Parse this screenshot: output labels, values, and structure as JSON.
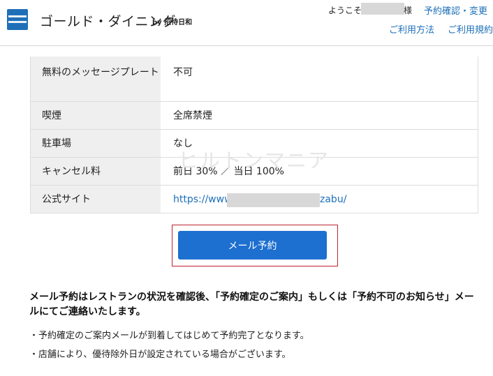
{
  "header": {
    "brand": "ゴールド・ダイニング",
    "brand_by": "by 招待日和",
    "welcome_prefix": "ようこそ",
    "welcome_suffix": "様",
    "links": [
      "予約確認・変更",
      "ご利用方法",
      "ご利用規約"
    ]
  },
  "details": {
    "rows": [
      {
        "label": "無料のメッセージプレート",
        "value": "不可"
      },
      {
        "label": "喫煙",
        "value": "全席禁煙"
      },
      {
        "label": "駐車場",
        "value": "なし"
      },
      {
        "label": "キャンセル料",
        "value": "前日 30% ／ 当日 100%"
      },
      {
        "label": "公式サイト",
        "value_prefix": "https://www",
        "value_suffix": "zabu/"
      }
    ]
  },
  "watermark": "ヒルトンマニア",
  "mail_button": "メール予約",
  "notice": "メール予約はレストランの状況を確認後、「予約確定のご案内」もしくは「予約不可のお知らせ」メールにてご連絡いたします。",
  "bullets": [
    "・予約確定のご案内メールが到着してはじめて予約完了となります。",
    "・店舗により、優待除外日が設定されている場合がございます。"
  ],
  "colors": {
    "accent": "#1d6fd0",
    "link": "#1d6fb8",
    "highlight_border": "#b8232f"
  }
}
